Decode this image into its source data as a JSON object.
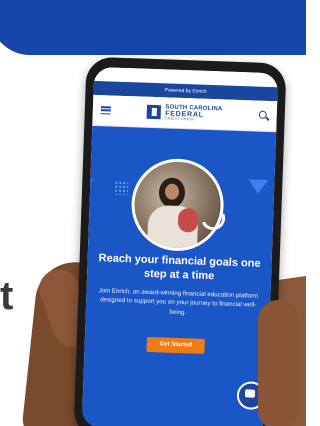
{
  "colors": {
    "brand_blue": "#1b46a0",
    "hero_blue": "#1b56c7",
    "cta_orange": "#f07b12"
  },
  "side_text": {
    "partial_letter": "t"
  },
  "phone": {
    "powered_by": "Powered by Enrich",
    "brand": {
      "line1": "SOUTH CAROLINA",
      "line2": "FEDERAL",
      "line3": "CREDIT UNION"
    },
    "icons": {
      "menu": "menu-icon",
      "search": "search-icon",
      "chat": "chat-icon"
    },
    "hero": {
      "title": "Reach your financial goals one step at a time",
      "body": "Join Enrich, an award-winning financial education platform designed to support you on your journey to financial well-being.",
      "cta_label": "Get Started"
    }
  }
}
